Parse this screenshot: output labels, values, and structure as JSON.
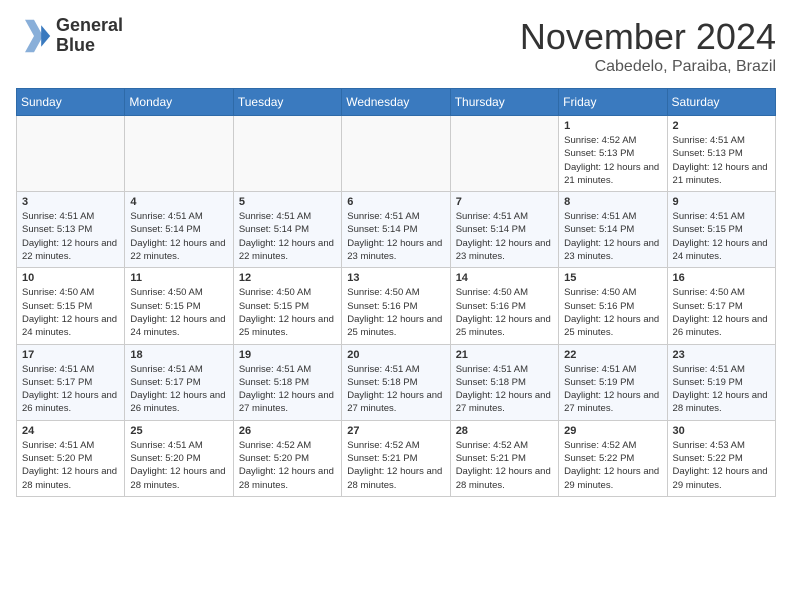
{
  "header": {
    "logo_line1": "General",
    "logo_line2": "Blue",
    "month": "November 2024",
    "location": "Cabedelo, Paraiba, Brazil"
  },
  "weekdays": [
    "Sunday",
    "Monday",
    "Tuesday",
    "Wednesday",
    "Thursday",
    "Friday",
    "Saturday"
  ],
  "weeks": [
    [
      {
        "day": "",
        "info": ""
      },
      {
        "day": "",
        "info": ""
      },
      {
        "day": "",
        "info": ""
      },
      {
        "day": "",
        "info": ""
      },
      {
        "day": "",
        "info": ""
      },
      {
        "day": "1",
        "info": "Sunrise: 4:52 AM\nSunset: 5:13 PM\nDaylight: 12 hours\nand 21 minutes."
      },
      {
        "day": "2",
        "info": "Sunrise: 4:51 AM\nSunset: 5:13 PM\nDaylight: 12 hours\nand 21 minutes."
      }
    ],
    [
      {
        "day": "3",
        "info": "Sunrise: 4:51 AM\nSunset: 5:13 PM\nDaylight: 12 hours\nand 22 minutes."
      },
      {
        "day": "4",
        "info": "Sunrise: 4:51 AM\nSunset: 5:14 PM\nDaylight: 12 hours\nand 22 minutes."
      },
      {
        "day": "5",
        "info": "Sunrise: 4:51 AM\nSunset: 5:14 PM\nDaylight: 12 hours\nand 22 minutes."
      },
      {
        "day": "6",
        "info": "Sunrise: 4:51 AM\nSunset: 5:14 PM\nDaylight: 12 hours\nand 23 minutes."
      },
      {
        "day": "7",
        "info": "Sunrise: 4:51 AM\nSunset: 5:14 PM\nDaylight: 12 hours\nand 23 minutes."
      },
      {
        "day": "8",
        "info": "Sunrise: 4:51 AM\nSunset: 5:14 PM\nDaylight: 12 hours\nand 23 minutes."
      },
      {
        "day": "9",
        "info": "Sunrise: 4:51 AM\nSunset: 5:15 PM\nDaylight: 12 hours\nand 24 minutes."
      }
    ],
    [
      {
        "day": "10",
        "info": "Sunrise: 4:50 AM\nSunset: 5:15 PM\nDaylight: 12 hours\nand 24 minutes."
      },
      {
        "day": "11",
        "info": "Sunrise: 4:50 AM\nSunset: 5:15 PM\nDaylight: 12 hours\nand 24 minutes."
      },
      {
        "day": "12",
        "info": "Sunrise: 4:50 AM\nSunset: 5:15 PM\nDaylight: 12 hours\nand 25 minutes."
      },
      {
        "day": "13",
        "info": "Sunrise: 4:50 AM\nSunset: 5:16 PM\nDaylight: 12 hours\nand 25 minutes."
      },
      {
        "day": "14",
        "info": "Sunrise: 4:50 AM\nSunset: 5:16 PM\nDaylight: 12 hours\nand 25 minutes."
      },
      {
        "day": "15",
        "info": "Sunrise: 4:50 AM\nSunset: 5:16 PM\nDaylight: 12 hours\nand 25 minutes."
      },
      {
        "day": "16",
        "info": "Sunrise: 4:50 AM\nSunset: 5:17 PM\nDaylight: 12 hours\nand 26 minutes."
      }
    ],
    [
      {
        "day": "17",
        "info": "Sunrise: 4:51 AM\nSunset: 5:17 PM\nDaylight: 12 hours\nand 26 minutes."
      },
      {
        "day": "18",
        "info": "Sunrise: 4:51 AM\nSunset: 5:17 PM\nDaylight: 12 hours\nand 26 minutes."
      },
      {
        "day": "19",
        "info": "Sunrise: 4:51 AM\nSunset: 5:18 PM\nDaylight: 12 hours\nand 27 minutes."
      },
      {
        "day": "20",
        "info": "Sunrise: 4:51 AM\nSunset: 5:18 PM\nDaylight: 12 hours\nand 27 minutes."
      },
      {
        "day": "21",
        "info": "Sunrise: 4:51 AM\nSunset: 5:18 PM\nDaylight: 12 hours\nand 27 minutes."
      },
      {
        "day": "22",
        "info": "Sunrise: 4:51 AM\nSunset: 5:19 PM\nDaylight: 12 hours\nand 27 minutes."
      },
      {
        "day": "23",
        "info": "Sunrise: 4:51 AM\nSunset: 5:19 PM\nDaylight: 12 hours\nand 28 minutes."
      }
    ],
    [
      {
        "day": "24",
        "info": "Sunrise: 4:51 AM\nSunset: 5:20 PM\nDaylight: 12 hours\nand 28 minutes."
      },
      {
        "day": "25",
        "info": "Sunrise: 4:51 AM\nSunset: 5:20 PM\nDaylight: 12 hours\nand 28 minutes."
      },
      {
        "day": "26",
        "info": "Sunrise: 4:52 AM\nSunset: 5:20 PM\nDaylight: 12 hours\nand 28 minutes."
      },
      {
        "day": "27",
        "info": "Sunrise: 4:52 AM\nSunset: 5:21 PM\nDaylight: 12 hours\nand 28 minutes."
      },
      {
        "day": "28",
        "info": "Sunrise: 4:52 AM\nSunset: 5:21 PM\nDaylight: 12 hours\nand 28 minutes."
      },
      {
        "day": "29",
        "info": "Sunrise: 4:52 AM\nSunset: 5:22 PM\nDaylight: 12 hours\nand 29 minutes."
      },
      {
        "day": "30",
        "info": "Sunrise: 4:53 AM\nSunset: 5:22 PM\nDaylight: 12 hours\nand 29 minutes."
      }
    ]
  ]
}
